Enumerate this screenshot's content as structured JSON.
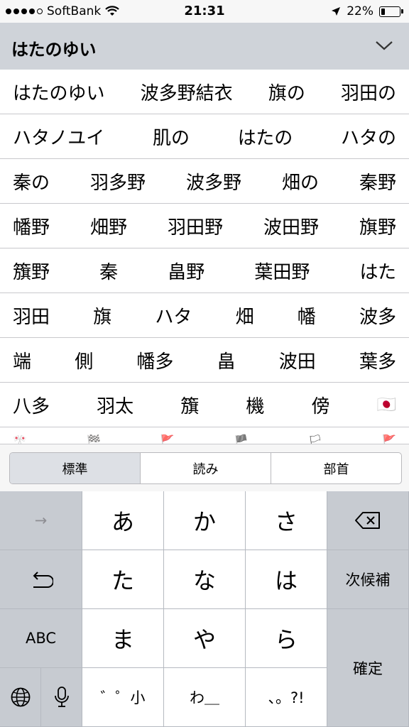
{
  "status_bar": {
    "carrier": "SoftBank",
    "time": "21:31",
    "battery_percent": "22%",
    "battery_level": 0.22,
    "signal_bars_filled": 4,
    "signal_bars_total": 5
  },
  "reading": {
    "text": "はたのゆい",
    "expand_icon": "chevron-down-icon"
  },
  "candidates": [
    [
      "はたのゆい",
      "波多野結衣",
      "旗の",
      "羽田の"
    ],
    [
      "ハタノユイ",
      "肌の",
      "はたの",
      "ハタの"
    ],
    [
      "秦の",
      "羽多野",
      "波多野",
      "畑の",
      "秦野"
    ],
    [
      "幡野",
      "畑野",
      "羽田野",
      "波田野",
      "旗野"
    ],
    [
      "籏野",
      "秦",
      "畠野",
      "葉田野",
      "はた"
    ],
    [
      "羽田",
      "旗",
      "ハタ",
      "畑",
      "幡",
      "波多"
    ],
    [
      "端",
      "側",
      "幡多",
      "畠",
      "波田",
      "葉多"
    ],
    [
      "八多",
      "羽太",
      "籏",
      "機",
      "傍",
      "🇯🇵"
    ],
    [
      "🎌",
      "🏁",
      "🚩",
      "🏴",
      "🏳",
      "🚩"
    ]
  ],
  "segment": {
    "options": [
      "標準",
      "読み",
      "部首"
    ],
    "selected": "標準"
  },
  "keyboard": {
    "left_keys": {
      "arrow": "→",
      "undo": "↶",
      "abc": "ABC"
    },
    "main_keys": [
      [
        "あ",
        "か",
        "さ"
      ],
      [
        "た",
        "な",
        "は"
      ],
      [
        "ま",
        "や",
        "ら"
      ],
      [
        "゛゜小",
        "わ＿",
        "、。?!"
      ]
    ],
    "right_keys": {
      "next_candidate": "次候補",
      "confirm": "確定"
    },
    "icons": {
      "globe": "globe-icon",
      "mic": "microphone-icon",
      "delete": "delete-icon"
    }
  }
}
